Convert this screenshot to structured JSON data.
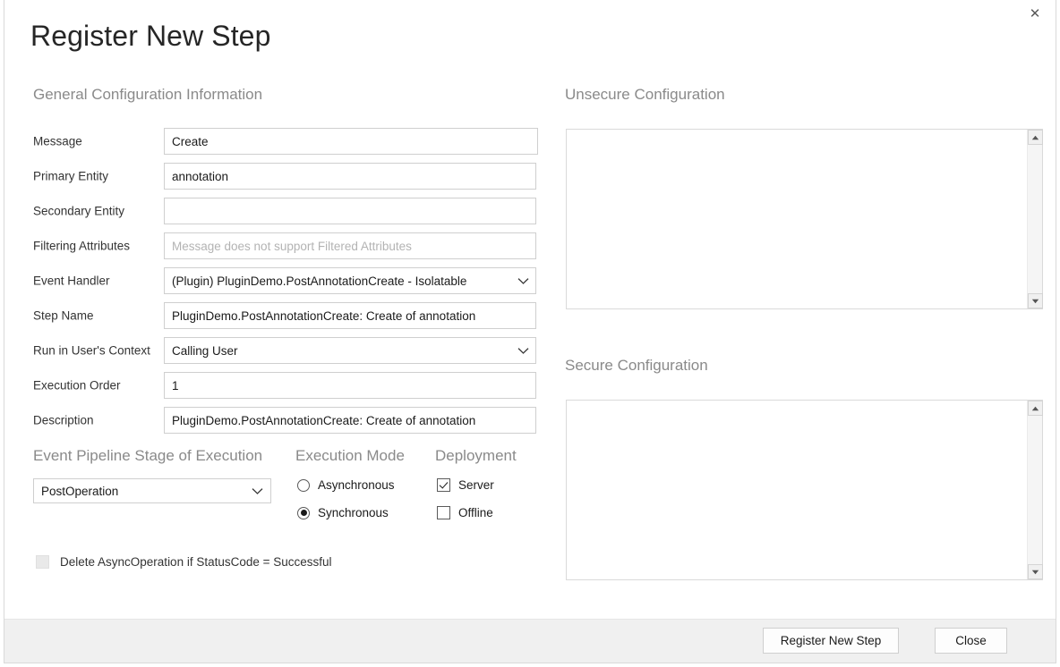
{
  "window": {
    "title": "Register New Step",
    "close_icon": "close-icon"
  },
  "sections": {
    "general": "General Configuration Information",
    "unsecure": "Unsecure  Configuration",
    "secure": "Secure  Configuration"
  },
  "general_form": {
    "fields": [
      {
        "label": "Message",
        "value": "Create",
        "placeholder": "",
        "type": "text"
      },
      {
        "label": "Primary Entity",
        "value": "annotation",
        "placeholder": "",
        "type": "text"
      },
      {
        "label": "Secondary Entity",
        "value": "",
        "placeholder": "",
        "type": "text"
      },
      {
        "label": "Filtering Attributes",
        "value": "",
        "placeholder": "Message does not support Filtered Attributes",
        "type": "text"
      },
      {
        "label": "Event Handler",
        "value": "(Plugin) PluginDemo.PostAnnotationCreate - Isolatable",
        "placeholder": "",
        "type": "combo"
      },
      {
        "label": "Step Name",
        "value": "PluginDemo.PostAnnotationCreate: Create of annotation",
        "placeholder": "",
        "type": "text"
      },
      {
        "label": "Run in User's Context",
        "value": "Calling User",
        "placeholder": "",
        "type": "combo"
      },
      {
        "label": "Execution Order",
        "value": "1",
        "placeholder": "",
        "type": "text"
      },
      {
        "label": "Description",
        "value": "PluginDemo.PostAnnotationCreate: Create of annotation",
        "placeholder": "",
        "type": "text"
      }
    ]
  },
  "pipeline": {
    "heading": "Event Pipeline Stage of Execution",
    "selected": "PostOperation"
  },
  "execution_mode": {
    "heading": "Execution Mode",
    "options": [
      {
        "label": "Asynchronous",
        "selected": false
      },
      {
        "label": "Synchronous",
        "selected": true
      }
    ]
  },
  "deployment": {
    "heading": "Deployment",
    "options": [
      {
        "label": "Server",
        "checked": true
      },
      {
        "label": "Offline",
        "checked": false
      }
    ]
  },
  "delete_async": {
    "label": "Delete AsyncOperation if StatusCode = Successful",
    "checked": false,
    "disabled": true
  },
  "config_panels": {
    "unsecure": {
      "value": "",
      "placeholder": ""
    },
    "secure": {
      "value": "",
      "placeholder": ""
    }
  },
  "scrollbar": {
    "up_icon": "caret-up-icon",
    "down_icon": "caret-down-icon"
  },
  "footer": {
    "register_label": "Register New Step",
    "close_label": "Close"
  },
  "colors": {
    "background": "#ffffff",
    "footer_bg": "#f0f0f0",
    "heading_gray": "#8a8a8a",
    "border": "#cfcfcf",
    "text": "#1a1a1a"
  }
}
